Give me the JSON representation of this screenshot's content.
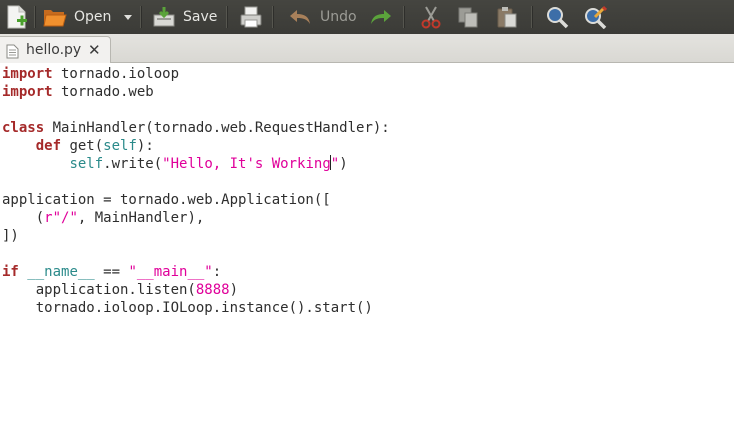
{
  "toolbar": {
    "new": {
      "icon": "new-document-icon"
    },
    "open": {
      "label": "Open",
      "icon": "folder-open-icon"
    },
    "save": {
      "label": "Save",
      "icon": "save-icon"
    },
    "print": {
      "icon": "printer-icon"
    },
    "undo": {
      "label": "Undo",
      "icon": "undo-icon",
      "enabled": false
    },
    "redo": {
      "icon": "redo-icon"
    },
    "cut": {
      "icon": "scissors-icon",
      "enabled": false
    },
    "copy": {
      "icon": "copy-icon",
      "enabled": false
    },
    "paste": {
      "icon": "paste-icon"
    },
    "find": {
      "icon": "search-icon"
    },
    "replace": {
      "icon": "find-replace-icon"
    }
  },
  "tab": {
    "filename": "hello.py",
    "close": "✕"
  },
  "code": {
    "l1_kw": "import",
    "l1_rest": " tornado.ioloop",
    "l2_kw": "import",
    "l2_rest": " tornado.web",
    "l4_kw": "class",
    "l4_rest": " MainHandler(tornado.web.RequestHandler):",
    "l5_indent": "    ",
    "l5_kw": "def",
    "l5_a": " get(",
    "l5_self": "self",
    "l5_b": "):",
    "l6_indent": "        ",
    "l6_self": "self",
    "l6_a": ".write(",
    "l6_str1": "\"Hello, It's Working",
    "l6_str2": "\"",
    "l6_b": ")",
    "l8": "application = tornado.web.Application([",
    "l9_a": "    (",
    "l9_str": "r\"/\"",
    "l9_b": ", MainHandler),",
    "l10": "])",
    "l12_kw": "if",
    "l12_sp": " ",
    "l12_dunder": "__name__",
    "l12_eq": " == ",
    "l12_str": "\"__main__\"",
    "l12_colon": ":",
    "l13_a": "    application.listen(",
    "l13_num": "8888",
    "l13_b": ")",
    "l14": "    tornado.ioloop.IOLoop.instance().start()"
  },
  "colors": {
    "toolbar_bg": "#3f3f3b",
    "keyword": "#a52a2a",
    "self": "#2a8a8a",
    "string": "#e0009a"
  }
}
